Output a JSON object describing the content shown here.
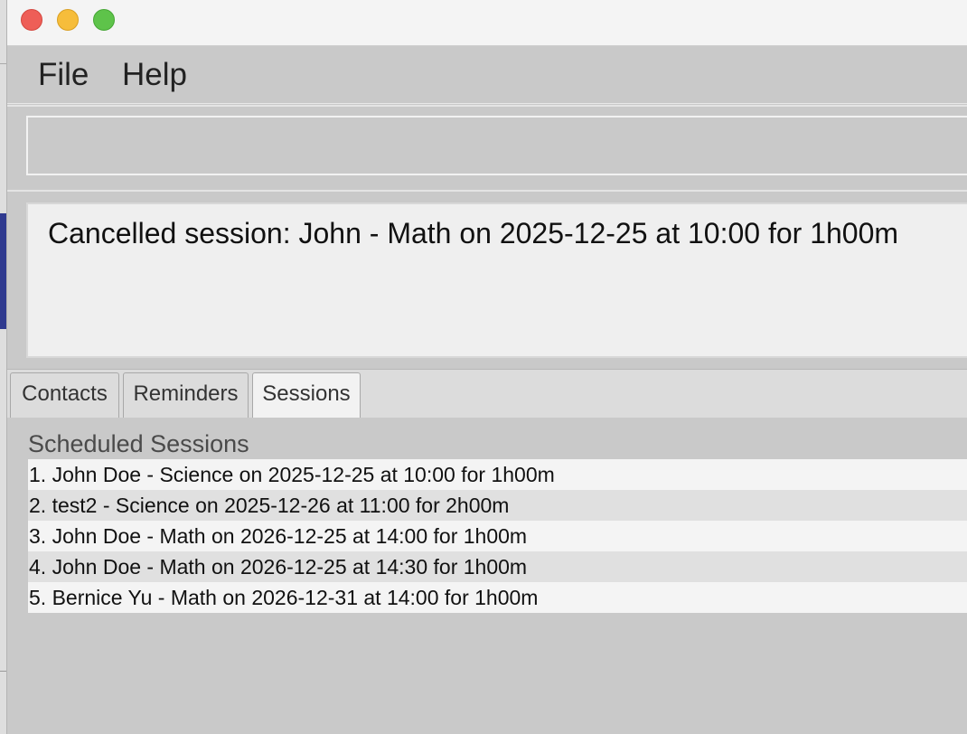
{
  "menu": {
    "file_label": "File",
    "help_label": "Help"
  },
  "command": {
    "value": "",
    "placeholder": ""
  },
  "result": {
    "message": "Cancelled session: John - Math on 2025-12-25 at 10:00 for 1h00m"
  },
  "tabs": [
    {
      "label": "Contacts",
      "selected": false
    },
    {
      "label": "Reminders",
      "selected": false
    },
    {
      "label": "Sessions",
      "selected": true
    }
  ],
  "sessions": {
    "title": "Scheduled Sessions",
    "items": [
      "1. John Doe - Science on 2025-12-25 at 10:00 for 1h00m",
      "2. test2 - Science on 2025-12-26 at 11:00 for 2h00m",
      "3. John Doe - Math on 2026-12-25 at 14:00 for 1h00m",
      "4. John Doe - Math on 2026-12-25 at 14:30 for 1h00m",
      "5. Bernice Yu - Math on 2026-12-31 at 14:00 for 1h00m"
    ]
  },
  "colors": {
    "close": "#ee5e57",
    "minimize": "#f6bd3b",
    "maximize": "#5ec34a",
    "background": "#c9c9c9"
  }
}
